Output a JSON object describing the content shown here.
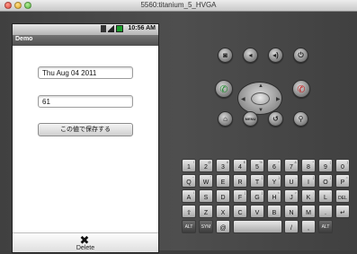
{
  "window": {
    "title": "5560:titanium_5_HVGA"
  },
  "statusbar": {
    "time": "10:56 AM"
  },
  "app": {
    "title": "Demo"
  },
  "form": {
    "date_value": "Thu Aug 04 2011",
    "number_value": "61",
    "save_button": "この値で保存する"
  },
  "bottom": {
    "delete_label": "Delete"
  },
  "hardware": {
    "menu_label": "MENU"
  },
  "keyboard": {
    "rows": [
      [
        {
          "k": "1",
          "s": "!"
        },
        {
          "k": "2",
          "s": "@"
        },
        {
          "k": "3",
          "s": "#"
        },
        {
          "k": "4",
          "s": "$"
        },
        {
          "k": "5",
          "s": "%"
        },
        {
          "k": "6",
          "s": "^"
        },
        {
          "k": "7",
          "s": "&"
        },
        {
          "k": "8",
          "s": "*"
        },
        {
          "k": "9",
          "s": "("
        },
        {
          "k": "0",
          "s": ")"
        }
      ],
      [
        {
          "k": "Q",
          "s": "~"
        },
        {
          "k": "W",
          "s": "\""
        },
        {
          "k": "E",
          "s": "´"
        },
        {
          "k": "R",
          "s": ""
        },
        {
          "k": "T",
          "s": "{"
        },
        {
          "k": "Y",
          "s": "}"
        },
        {
          "k": "U",
          "s": "-"
        },
        {
          "k": "I",
          "s": "["
        },
        {
          "k": "O",
          "s": "]"
        },
        {
          "k": "P",
          "s": "="
        }
      ],
      [
        {
          "k": "A",
          "s": "\\"
        },
        {
          "k": "S",
          "s": ""
        },
        {
          "k": "D",
          "s": ""
        },
        {
          "k": "F",
          "s": "["
        },
        {
          "k": "G",
          "s": "]"
        },
        {
          "k": "H",
          "s": "<"
        },
        {
          "k": "J",
          "s": ">"
        },
        {
          "k": "K",
          "s": ";"
        },
        {
          "k": "L",
          "s": ":"
        },
        {
          "k": "DEL",
          "s": ""
        }
      ],
      [
        {
          "k": "⇧",
          "s": ""
        },
        {
          "k": "Z",
          "s": ""
        },
        {
          "k": "X",
          "s": ""
        },
        {
          "k": "C",
          "s": ""
        },
        {
          "k": "V",
          "s": ""
        },
        {
          "k": "B",
          "s": ""
        },
        {
          "k": "N",
          "s": ""
        },
        {
          "k": "M",
          "s": ""
        },
        {
          "k": ".",
          "s": ""
        },
        {
          "k": "↵",
          "s": ""
        }
      ]
    ],
    "bottom_row": {
      "alt_left": "ALT",
      "sym": "SYM",
      "at": "@",
      "space": "",
      "slash": "/",
      "comma": ",",
      "alt_right": "ALT"
    }
  }
}
